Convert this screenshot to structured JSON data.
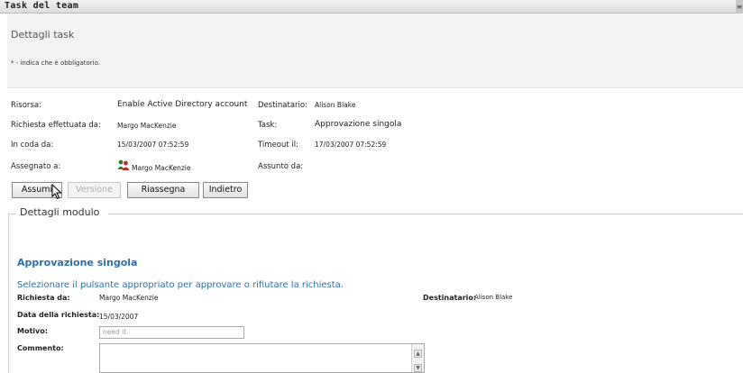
{
  "window": {
    "title": "Task del team"
  },
  "header": {
    "subtitle": "Dettagli task",
    "required_note": "* - indica che è obbligatorio."
  },
  "details": {
    "risorsa_label": "Risorsa:",
    "risorsa_value": "Enable Active Directory account",
    "destinatario_label": "Destinatario:",
    "destinatario_value": "Alison Blake",
    "richiesta_label": "Richiesta effettuata da:",
    "richiesta_value": "Margo MacKenzie",
    "task_label": "Task:",
    "task_value": "Approvazione singola",
    "in_coda_label": "In coda da:",
    "in_coda_value": "15/03/2007 07:52:59",
    "timeout_label": "Timeout il:",
    "timeout_value": "17/03/2007 07:52:59",
    "assegnato_label": "Assegnato a:",
    "assegnato_value": "Margo MacKenzie",
    "assunto_label": "Assunto da:",
    "assunto_value": ""
  },
  "buttons": {
    "assumi": "Assumi",
    "versione": "Versione",
    "riassegna": "Riassegna",
    "indietro": "Indietro"
  },
  "form_section": {
    "legend": "Dettagli modulo",
    "title": "Approvazione singola",
    "instruction": "Selezionare il pulsante appropriato per approvare o rifiutare la richiesta.",
    "richiesta_da_label": "Richiesta da:",
    "richiesta_da_value": "Margo MacKenzie",
    "destinatario_label": "Destinatario:",
    "destinatario_value": "Alison Blake",
    "data_label": "Data della richiesta:",
    "data_value": "15/03/2007",
    "motivo_label": "Motivo:",
    "motivo_value": "need it",
    "commento_label": "Commento:",
    "commento_value": ""
  },
  "icons": {
    "user_icon": "user-group-icon",
    "cursor": "mouse-pointer-icon"
  }
}
